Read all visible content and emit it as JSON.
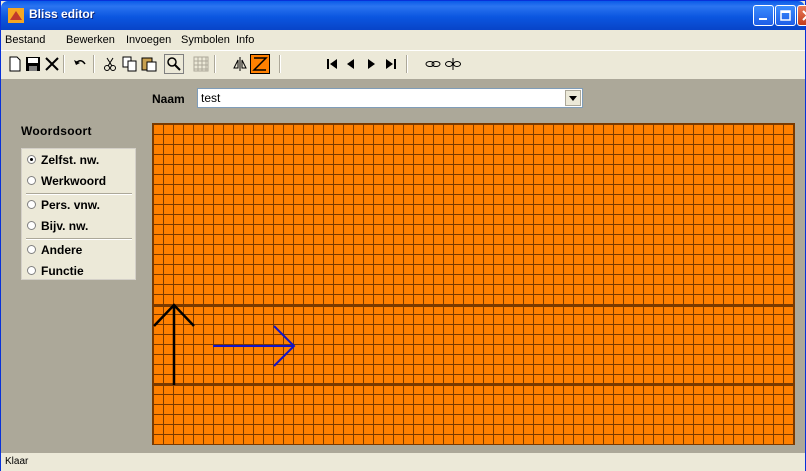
{
  "window": {
    "title": "Bliss editor"
  },
  "titlebar_buttons": {
    "minimize": "minimize-icon",
    "maximize": "maximize-icon",
    "close": "close-icon"
  },
  "menu": {
    "items": [
      "Bestand",
      "Bewerken",
      "Invoegen",
      "Symbolen",
      "Info"
    ]
  },
  "toolbar": {
    "buttons": [
      "new-icon",
      "save-icon",
      "delete-icon",
      "undo-icon",
      "cut-icon",
      "copy-icon",
      "paste-icon",
      "zoom-icon",
      "grid-icon",
      "mirror-icon",
      "draw-icon",
      "first-icon",
      "previous-icon",
      "next-icon",
      "last-icon",
      "link-icon",
      "unlink-icon"
    ]
  },
  "naam": {
    "label": "Naam",
    "value": "test"
  },
  "woordsoort": {
    "label": "Woordsoort",
    "options": [
      "Zelfst. nw.",
      "Werkwoord",
      "Pers. vnw.",
      "Bijv. nw.",
      "Andere",
      "Functie"
    ],
    "selected": "Zelfst. nw."
  },
  "canvas": {
    "grid_color": "#ff8000",
    "line_color": "#7a3a00",
    "symbols": [
      "up-arrow",
      "right-arrow"
    ],
    "symbol_colors": {
      "up_arrow": "#000000",
      "right_arrow": "#1414c8"
    }
  },
  "status": {
    "text": "Klaar"
  }
}
